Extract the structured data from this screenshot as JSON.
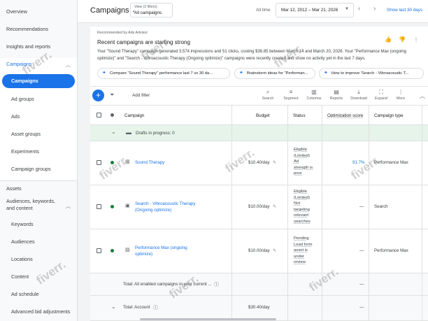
{
  "sidebar": {
    "overview": "Overview",
    "recommendations": "Recommendations",
    "insights": "Insights and reports",
    "campaigns_header": "Campaigns",
    "campaigns": "Campaigns",
    "ad_groups": "Ad groups",
    "ads": "Ads",
    "asset_groups": "Asset groups",
    "experiments": "Experiments",
    "campaign_groups": "Campaign groups",
    "assets": "Assets",
    "audiences_header": "Audiences, keywords, and content",
    "keywords": "Keywords",
    "audiences": "Audiences",
    "locations": "Locations",
    "content": "Content",
    "ad_schedule": "Ad schedule",
    "advanced_bid": "Advanced bid adjustments"
  },
  "header": {
    "title": "Campaigns",
    "view_filters": "View (2 filters)",
    "view_value": "All campaigns",
    "all_time": "All time",
    "date_range": "Mar 12, 2012 – Mar 21, 2026",
    "last_30": "Show last 30 days"
  },
  "recommendation": {
    "tag": "Recommended by Ads Advisor",
    "title": "Recent campaigns are starting strong",
    "text": "Your \"Sound Therapy\" campaign generated 3,574 impressions and 51 clicks, costing $36.85 between March 14 and March 20, 2026. Your \"Performance Max (ongoing optimize)\" and \"Search - Vibroacoustic Therapy (Ongoing optimize)\" campaigns were recently created and show no activity yet in the last 7 days.",
    "chips": [
      "Compare \"Sound Therapy\" performance last 7 vs 30 da...",
      "Brainstorm ideas for \"Performan...",
      "How to improve 'Search - Vibroacoustic T..."
    ]
  },
  "toolbar": {
    "add_filter": "Add filter",
    "search": "Search",
    "segment": "Segment",
    "columns": "Columns",
    "reports": "Reports",
    "download": "Download",
    "expand": "Expand",
    "more": "More"
  },
  "table": {
    "headers": {
      "campaign": "Campaign",
      "budget": "Budget",
      "status": "Status",
      "optimization": "Optimization score",
      "type": "Campaign type"
    },
    "drafts": "Drafts in progress: 0",
    "rows": [
      {
        "name": "Sound Therapy",
        "budget": "$10.40/day",
        "status": [
          "Eligible",
          "(Limited)",
          "Ad",
          "strength is",
          "poor"
        ],
        "score": "91.7%",
        "type": "Performance Max"
      },
      {
        "name": "Search - Vibroacoustic Therapy (Ongoing optimize)",
        "budget": "$10.00/day",
        "status": [
          "Eligible",
          "(Limited)",
          "Not",
          "targeting",
          "relevant",
          "searches"
        ],
        "score": "—",
        "type": "Search"
      },
      {
        "name": "Performance Max (ongoing optimize)",
        "budget": "$10.00/day",
        "status": [
          "Pending",
          "Lead form",
          "asset is",
          "under",
          "review"
        ],
        "score": "—",
        "type": "Performance Max"
      }
    ],
    "total_enabled": "Total: All enabled campaigns in your current ...",
    "total_enabled_score": "—",
    "total_account": "Total: Account",
    "total_account_budget": "$30.40/day",
    "total_account_score": "—"
  },
  "watermark": "fiverr."
}
